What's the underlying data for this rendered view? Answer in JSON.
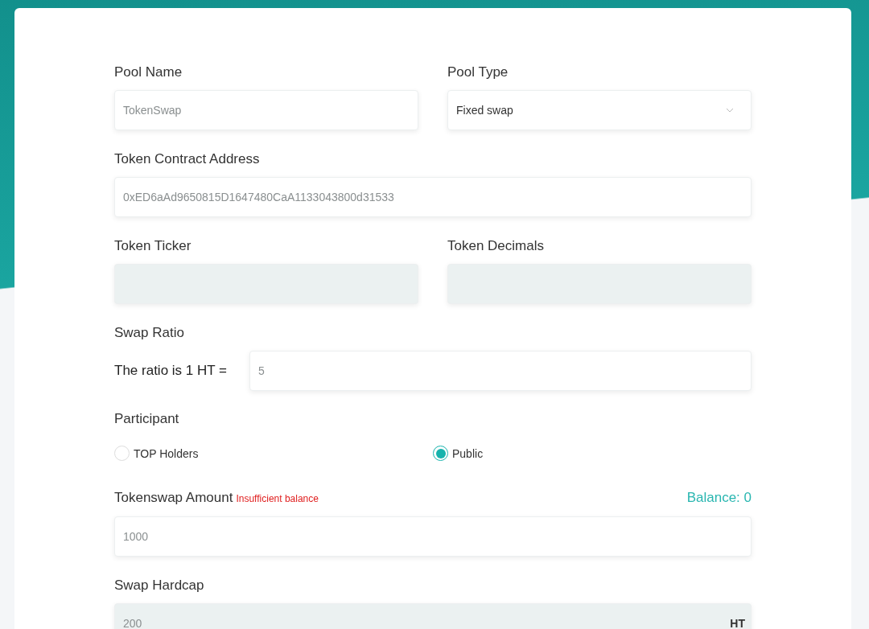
{
  "form": {
    "pool_name": {
      "label": "Pool Name",
      "placeholder": "TokenSwap",
      "disabled": false
    },
    "pool_type": {
      "label": "Pool Type",
      "value": "Fixed swap"
    },
    "token_contract_address": {
      "label": "Token Contract Address",
      "placeholder": "0xED6aAd9650815D1647480CaA1133043800d31533",
      "disabled": false
    },
    "token_ticker": {
      "label": "Token Ticker",
      "disabled": true
    },
    "token_decimals": {
      "label": "Token Decimals",
      "disabled": true
    },
    "swap_ratio": {
      "label": "Swap Ratio",
      "prefix": "The ratio is 1 HT =",
      "placeholder": "5",
      "disabled": false
    },
    "participant": {
      "label": "Participant",
      "options": [
        {
          "label": "TOP Holders",
          "selected": false
        },
        {
          "label": "Public",
          "selected": true
        }
      ]
    },
    "tokenswap_amount": {
      "label": "Tokenswap Amount",
      "error": "Insufficient balance",
      "balance": "Balance: 0",
      "placeholder": "1000",
      "disabled": false
    },
    "swap_hardcap": {
      "label": "Swap Hardcap",
      "placeholder": "200",
      "suffix": "HT",
      "disabled": true
    }
  }
}
